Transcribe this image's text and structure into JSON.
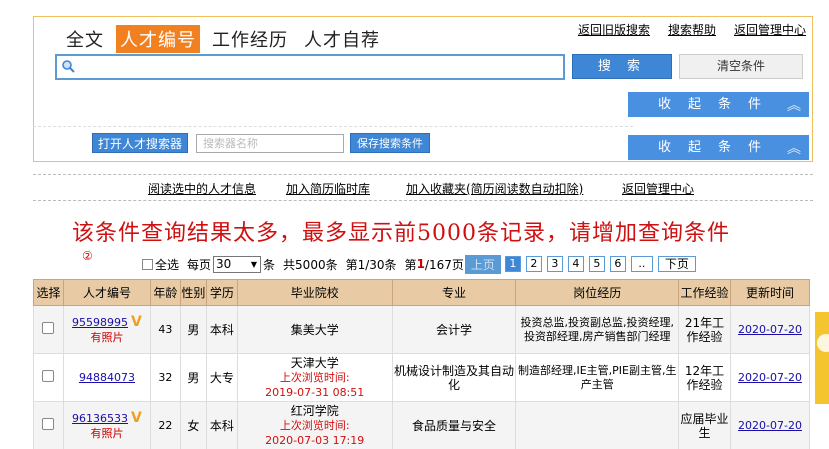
{
  "tabs": [
    {
      "label": "全文",
      "active": false
    },
    {
      "label": "人才编号",
      "active": true
    },
    {
      "label": "工作经历",
      "active": false
    },
    {
      "label": "人才自荐",
      "active": false
    }
  ],
  "toplinks": {
    "old": "返回旧版搜索",
    "help": "搜索帮助",
    "admin": "返回管理中心"
  },
  "search": {
    "value": "",
    "button": "搜 索",
    "clear": "清空条件"
  },
  "collapse": {
    "label": "收起条件",
    "chevron": "︽"
  },
  "searcher": {
    "open": "打开人才搜索器",
    "placeholder": "搜索器名称",
    "save": "保存搜索条件"
  },
  "actions": {
    "read": "阅读选中的人才信息",
    "temp": "加入简历临时库",
    "fav": "加入收藏夹(简历阅读数自动扣除)",
    "back": "返回管理中心"
  },
  "warning": "该条件查询结果太多，最多显示前5000条记录，请增加查询条件",
  "marker": "②",
  "pager": {
    "select_all": "全选",
    "per_page_prefix": "每页",
    "per_page": "30",
    "per_page_suffix": "条",
    "total": "共5000条",
    "records": "第1/30条",
    "page_prefix": "第",
    "page_cur": "1",
    "page_suffix": "/167页",
    "prev": "上页",
    "pages": [
      "1",
      "2",
      "3",
      "4",
      "5",
      "6",
      ".."
    ],
    "next": "下页"
  },
  "table": {
    "headers": [
      "选择",
      "人才编号",
      "年龄",
      "性别",
      "学历",
      "毕业院校",
      "专业",
      "岗位经历",
      "工作经验",
      "更新时间"
    ],
    "rows": [
      {
        "id": "95598995",
        "vmark": "V",
        "photo": "有照片",
        "age": "43",
        "sex": "男",
        "edu": "本科",
        "school": "集美大学",
        "browse_label": "",
        "browse_time": "",
        "major": "会计学",
        "positions": "投资总监,投资副总监,投资经理,投资部经理,房产销售部门经理",
        "experience": "21年工作经验",
        "updated": "2020-07-20"
      },
      {
        "id": "94884073",
        "vmark": "",
        "photo": "",
        "age": "32",
        "sex": "男",
        "edu": "大专",
        "school": "天津大学",
        "browse_label": "上次浏览时间:",
        "browse_time": "2019-07-31 08:51",
        "major": "机械设计制造及其自动化",
        "positions": "制造部经理,IE主管,PIE副主管,生产主管",
        "experience": "12年工作经验",
        "updated": "2020-07-20"
      },
      {
        "id": "96136533",
        "vmark": "V",
        "photo": "有照片",
        "age": "22",
        "sex": "女",
        "edu": "本科",
        "school": "红河学院",
        "browse_label": "上次浏览时间:",
        "browse_time": "2020-07-03 17:19",
        "major": "食品质量与安全",
        "positions": "",
        "experience": "应届毕业生",
        "updated": "2020-07-20"
      }
    ]
  },
  "colors": {
    "accent_orange": "#f08020",
    "button_blue": "#3e86d6",
    "warning_red": "#d01010",
    "header_tan": "#e8cba4"
  }
}
